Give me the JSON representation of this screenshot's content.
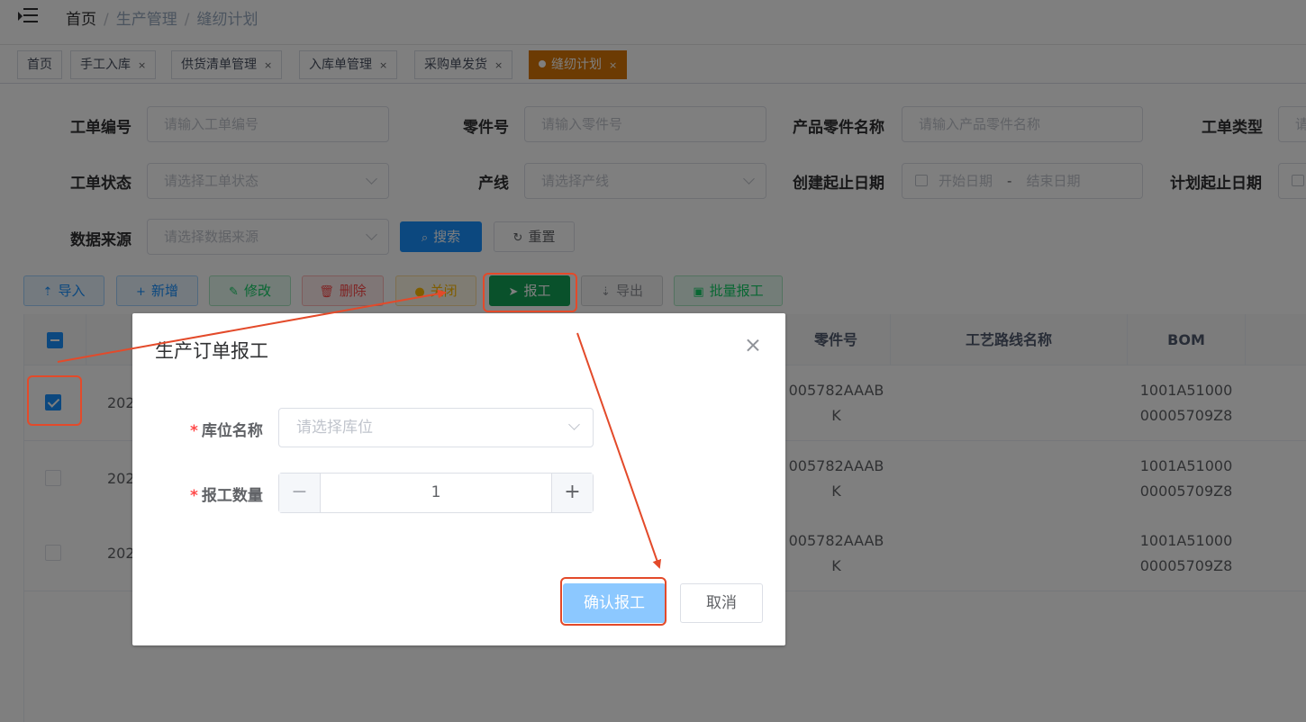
{
  "breadcrumb": [
    "首页",
    "生产管理",
    "缝纫计划"
  ],
  "breadcrumb_sep": "/",
  "tabs": [
    {
      "label": "首页",
      "closable": false
    },
    {
      "label": "手工入库",
      "closable": true
    },
    {
      "label": "供货清单管理",
      "closable": true
    },
    {
      "label": "入库单管理",
      "closable": true
    },
    {
      "label": "采购单发货",
      "closable": true
    },
    {
      "label": "缝纫计划",
      "closable": true,
      "active": true
    }
  ],
  "close_glyph": "×",
  "search": {
    "order_no": {
      "label": "工单编号",
      "placeholder": "请输入工单编号"
    },
    "part_no": {
      "label": "零件号",
      "placeholder": "请输入零件号"
    },
    "part_name": {
      "label": "产品零件名称",
      "placeholder": "请输入产品零件名称"
    },
    "order_type": {
      "label": "工单类型",
      "placeholder": "请"
    },
    "order_status": {
      "label": "工单状态",
      "placeholder": "请选择工单状态"
    },
    "line": {
      "label": "产线",
      "placeholder": "请选择产线"
    },
    "created_range": {
      "label": "创建起止日期",
      "start": "开始日期",
      "end": "结束日期",
      "dash": "-"
    },
    "plan_range": {
      "label": "计划起止日期"
    },
    "source": {
      "label": "数据来源",
      "placeholder": "请选择数据来源"
    },
    "search_btn": "搜索",
    "reset_btn": "重置"
  },
  "toolbar": {
    "import": "导入",
    "add": "新增",
    "edit": "修改",
    "delete": "删除",
    "close": "关闭",
    "report": "报工",
    "export": "导出",
    "batch_report": "批量报工"
  },
  "table": {
    "headers": {
      "part_no": "零件号",
      "route_name": "工艺路线名称",
      "bom": "BOM"
    },
    "rows": [
      {
        "selected": true,
        "col1": "202",
        "part_no": "005782AAAB\nK",
        "bom": "1001A51000\n00005709Z8"
      },
      {
        "selected": false,
        "col1": "202",
        "part_no": "005782AAAB\nK",
        "bom": "1001A51000\n00005709Z8"
      },
      {
        "selected": false,
        "col1": "202",
        "part_no": "005782AAAB\nK",
        "bom": "1001A51000\n00005709Z8"
      }
    ]
  },
  "dialog": {
    "title": "生产订单报工",
    "location_label": "库位名称",
    "location_placeholder": "请选择库位",
    "qty_label": "报工数量",
    "qty_value": "1",
    "minus": "−",
    "plus": "+",
    "required_mark": "*",
    "confirm": "确认报工",
    "cancel": "取消"
  },
  "colors": {
    "accent": "#1890ff",
    "active_tab": "#d97706",
    "report_green": "#13a356",
    "annotation_red": "#e34a2a"
  },
  "icons": [
    "menu-fold-icon",
    "upload-icon",
    "plus-icon",
    "edit-icon",
    "delete-icon",
    "close-circle-icon",
    "send-icon",
    "download-icon",
    "document-check-icon",
    "search-icon",
    "refresh-icon",
    "calendar-icon",
    "chevron-down-icon",
    "close-icon"
  ]
}
